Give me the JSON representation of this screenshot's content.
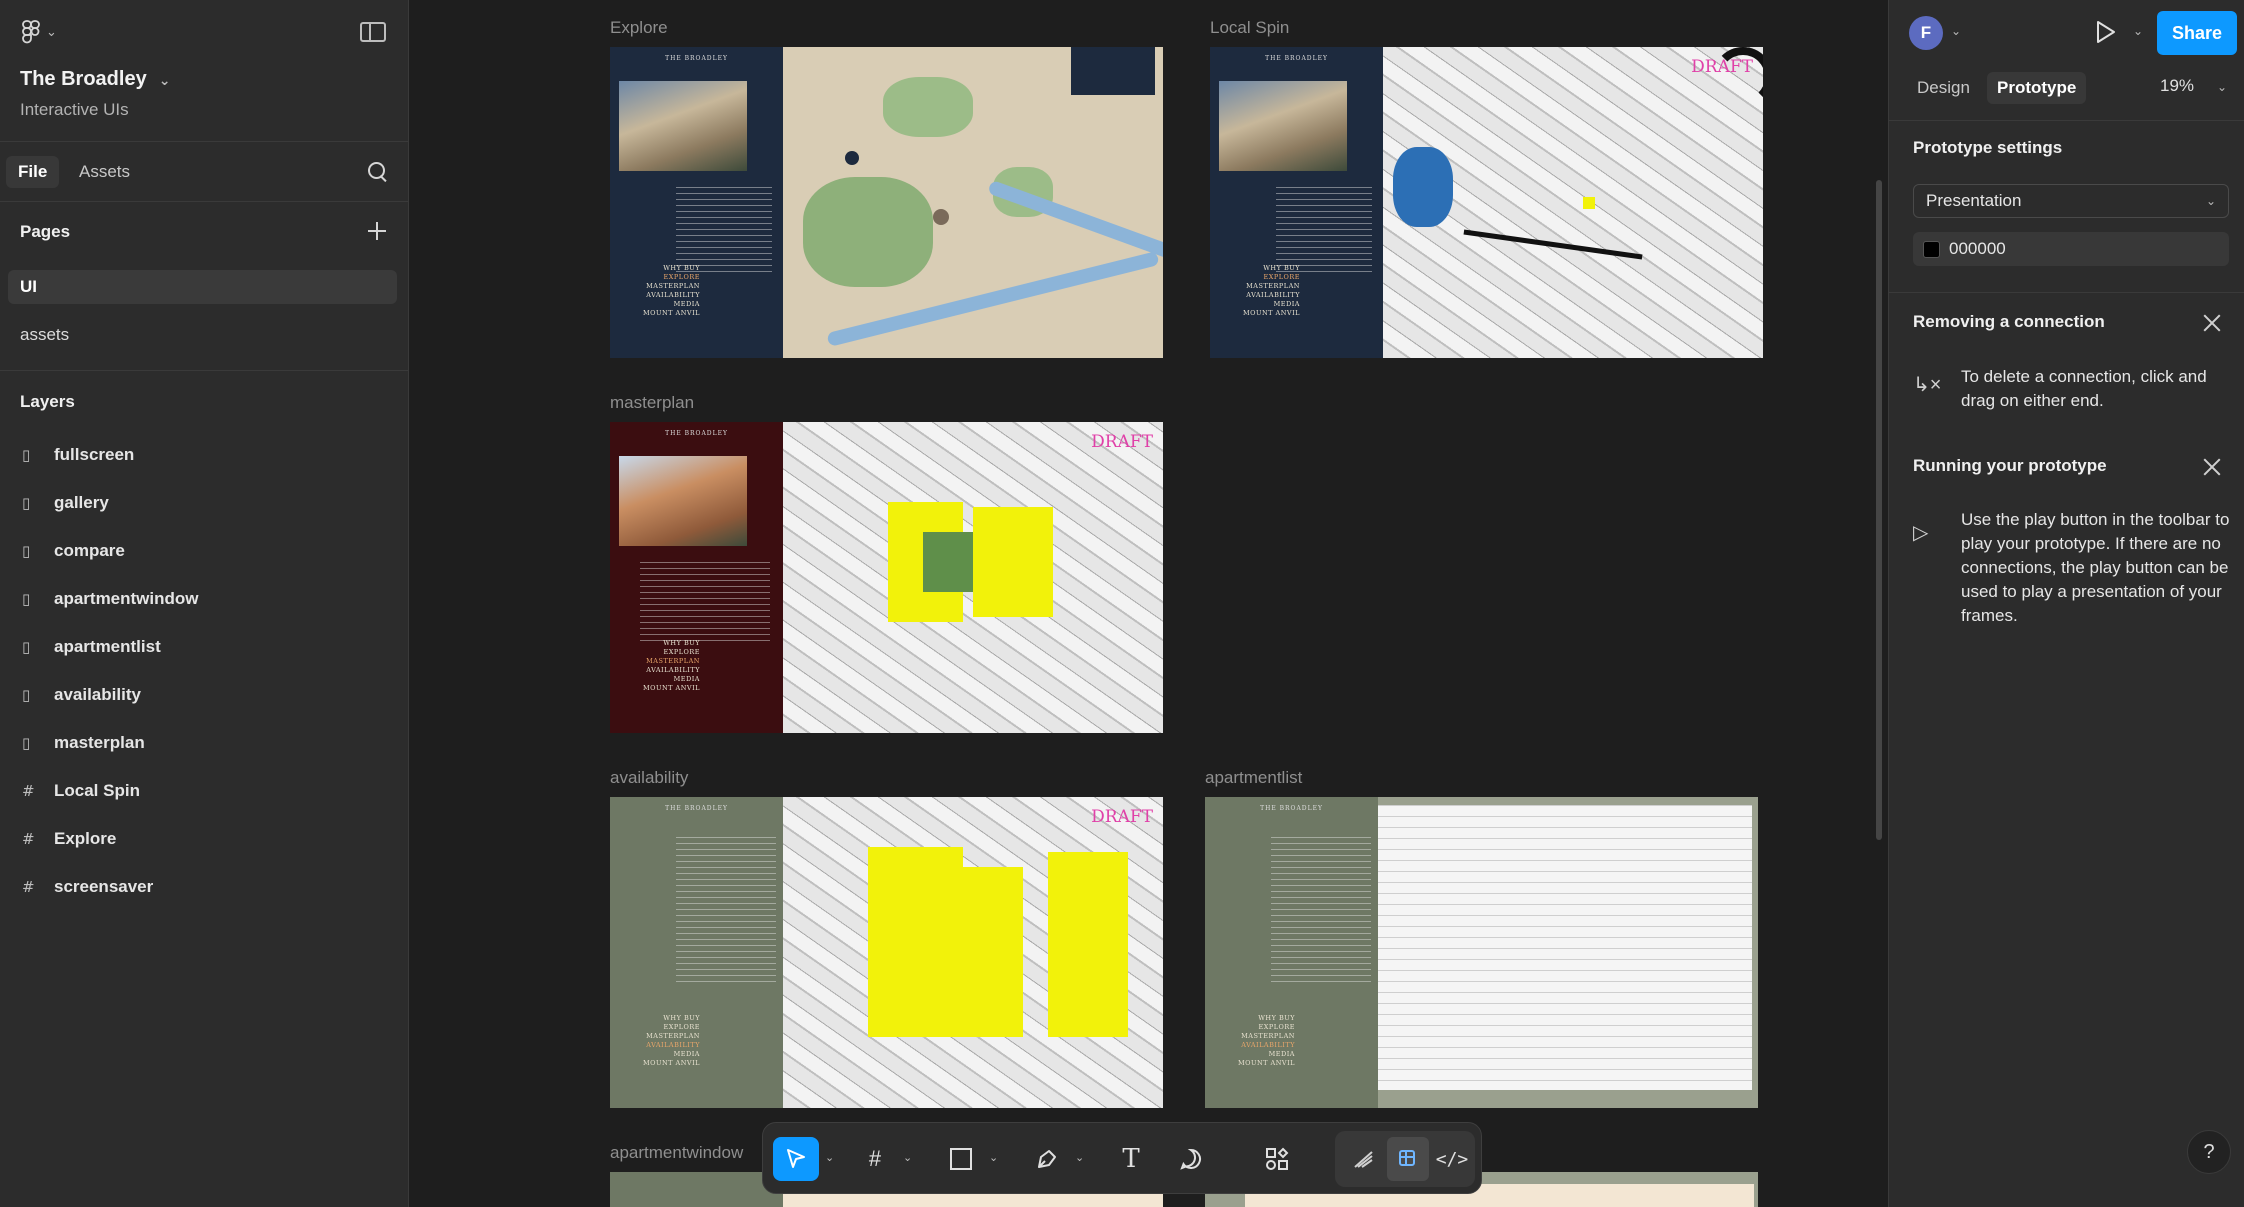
{
  "left_panel": {
    "project_name": "The Broadley",
    "project_sub": "Interactive UIs",
    "tabs": [
      "File",
      "Assets"
    ],
    "pages_heading": "Pages",
    "pages": [
      "UI",
      "assets"
    ],
    "layers_heading": "Layers",
    "layers": [
      {
        "label": "fullscreen",
        "icon": "component-icon"
      },
      {
        "label": "gallery",
        "icon": "component-icon"
      },
      {
        "label": "compare",
        "icon": "component-icon"
      },
      {
        "label": "apartmentwindow",
        "icon": "component-icon"
      },
      {
        "label": "apartmentlist",
        "icon": "component-icon"
      },
      {
        "label": "availability",
        "icon": "component-icon"
      },
      {
        "label": "masterplan",
        "icon": "component-icon"
      },
      {
        "label": "Local Spin",
        "icon": "frame-icon"
      },
      {
        "label": "Explore",
        "icon": "frame-icon"
      },
      {
        "label": "screensaver",
        "icon": "frame-icon"
      }
    ]
  },
  "canvas": {
    "frames": [
      {
        "label": "Explore"
      },
      {
        "label": "Local Spin"
      },
      {
        "label": "masterplan"
      },
      {
        "label": "availability"
      },
      {
        "label": "apartmentlist"
      },
      {
        "label": "apartmentwindow"
      }
    ],
    "brand": "THE BROADLEY",
    "menu_items": [
      "WHY BUY",
      "EXPLORE",
      "MASTERPLAN",
      "AVAILABILITY",
      "MEDIA",
      "MOUNT ANVIL"
    ],
    "draft_label": "DRAFT"
  },
  "right_panel": {
    "avatar_initial": "F",
    "share_label": "Share",
    "tabs": [
      "Design",
      "Prototype"
    ],
    "zoom": "19%",
    "prototype_settings_heading": "Prototype settings",
    "device_select": "Presentation",
    "background_color": "000000",
    "removing_heading": "Removing a connection",
    "removing_text": "To delete a connection, click and drag on either end.",
    "running_heading": "Running your prototype",
    "running_text": "Use the play button in the toolbar to play your prototype. If there are no connections, the play button can be used to play a presentation of your frames.",
    "help_label": "?"
  },
  "colors": {
    "accent": "#0d99ff",
    "panel": "#2c2c2c",
    "canvas": "#1e1e1e",
    "draft": "#e040a8",
    "building_highlight": "#f2f20a"
  }
}
